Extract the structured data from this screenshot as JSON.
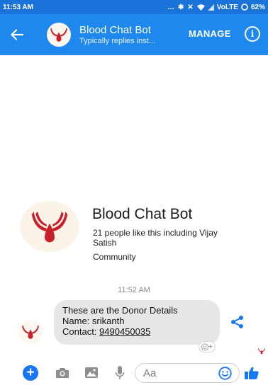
{
  "status_bar": {
    "time": "11:53 AM",
    "network": "VoLTE",
    "battery": "62%",
    "icons": [
      "notification-dots-icon",
      "bluetooth-icon",
      "mute-icon",
      "wifi-icon",
      "signal-icon",
      "battery-icon"
    ]
  },
  "header": {
    "title": "Blood Chat Bot",
    "subtitle": "Typically replies inst...",
    "manage_label": "MANAGE",
    "info_label": "i"
  },
  "profile": {
    "name": "Blood Chat Bot",
    "likes": "21 people like this including Vijay Satish",
    "category": "Community"
  },
  "conversation": {
    "timestamp": "11:52 AM",
    "message": {
      "line1": "These are the Donor  Details",
      "line2": "Name: srikanth",
      "line3_label": "Contact: ",
      "phone": "9490450035"
    }
  },
  "composer": {
    "placeholder": "Aa",
    "plus_label": "+"
  },
  "colors": {
    "status_bar": "#1a73d9",
    "header": "#1e88ee",
    "accent": "#1877f2",
    "logo_red": "#c8202a",
    "bubble": "#e7e7e7"
  }
}
